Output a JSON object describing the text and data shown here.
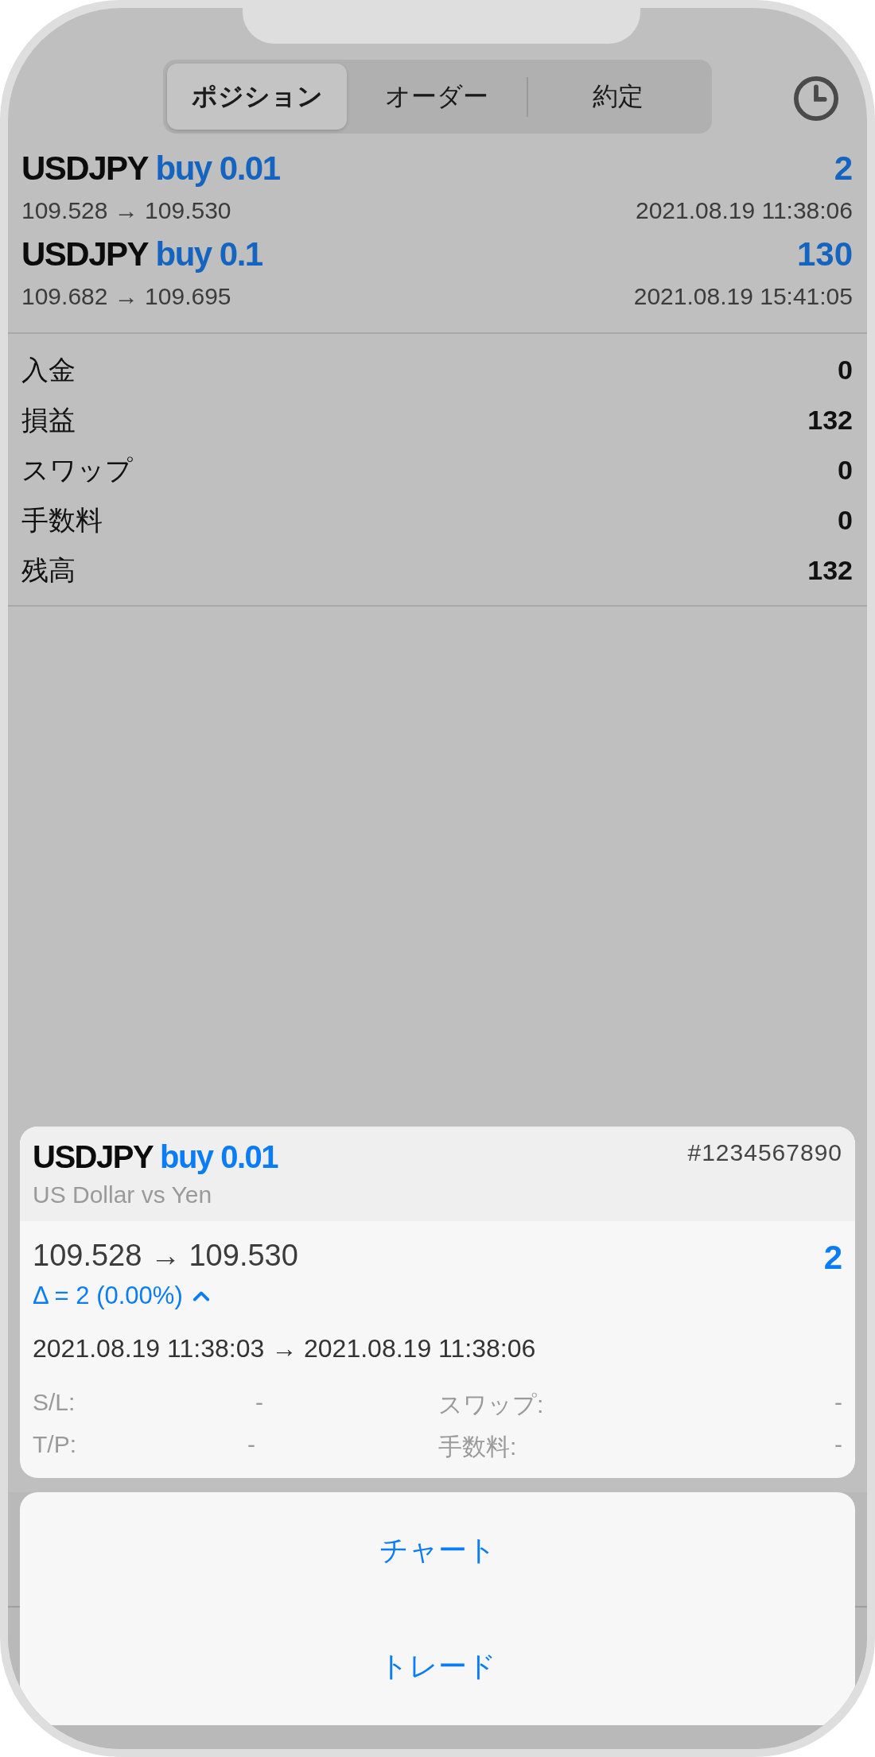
{
  "tabs": [
    {
      "label": "ポジション",
      "selected": true
    },
    {
      "label": "オーダー",
      "selected": false
    },
    {
      "label": "約定",
      "selected": false
    }
  ],
  "positions": [
    {
      "symbol": "USDJPY",
      "trade": "buy 0.01",
      "profit": "2",
      "prices": "109.528 → 109.530",
      "time": "2021.08.19 11:38:06"
    },
    {
      "symbol": "USDJPY",
      "trade": "buy 0.1",
      "profit": "130",
      "prices": "109.682 → 109.695",
      "time": "2021.08.19 15:41:05"
    }
  ],
  "summary": [
    {
      "label": "入金",
      "value": "0"
    },
    {
      "label": "損益",
      "value": "132"
    },
    {
      "label": "スワップ",
      "value": "0"
    },
    {
      "label": "手数料",
      "value": "0"
    },
    {
      "label": "残高",
      "value": "132"
    }
  ],
  "detail": {
    "symbol": "USDJPY",
    "trade": "buy 0.01",
    "ticket": "#1234567890",
    "description": "US Dollar vs Yen",
    "prices": "109.528 → 109.530",
    "profit": "2",
    "delta": "Δ = 2 (0.00%)",
    "expanded": true,
    "times": "2021.08.19 11:38:03 → 2021.08.19 11:38:06",
    "fields": [
      {
        "label": "S/L:",
        "value": "-"
      },
      {
        "label": "スワップ:",
        "value": "-"
      },
      {
        "label": "T/P:",
        "value": "-"
      },
      {
        "label": "手数料:",
        "value": "-"
      }
    ]
  },
  "actions": [
    "チャート",
    "トレード"
  ]
}
